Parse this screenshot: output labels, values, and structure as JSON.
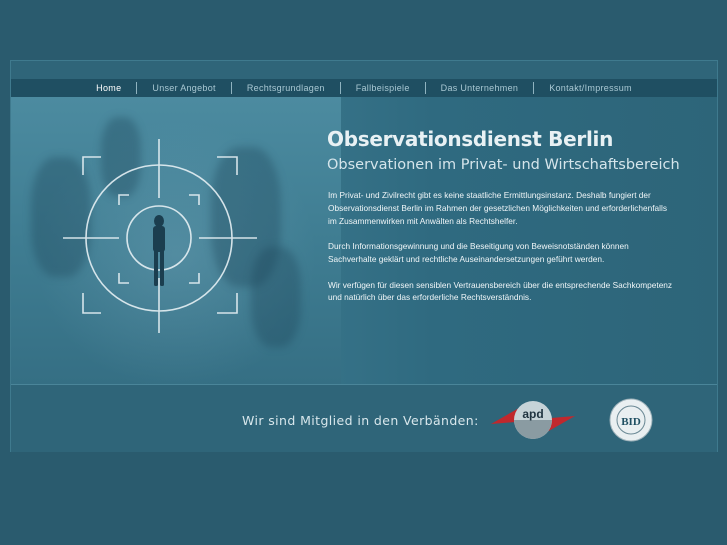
{
  "nav": {
    "items": [
      {
        "label": "Home",
        "active": true
      },
      {
        "label": "Unser Angebot"
      },
      {
        "label": "Rechtsgrundlagen"
      },
      {
        "label": "Fallbeispiele"
      },
      {
        "label": "Das Unternehmen"
      },
      {
        "label": "Kontakt/Impressum"
      }
    ]
  },
  "hero": {
    "title": "Observationsdienst Berlin",
    "subtitle": "Observationen im Privat- und Wirtschaftsbereich",
    "paragraphs": [
      "Im Privat- und Zivilrecht gibt es keine staatliche Ermittlungsinstanz. Deshalb fungiert der Observationsdienst Berlin im Rahmen der gesetzlichen Möglichkeiten und erforderlichenfalls im Zusammenwirken mit Anwälten als Rechtshelfer.",
      "Durch Informationsgewinnung und die Beseitigung von Beweisnotständen können Sachverhalte geklärt und rechtliche Auseinandersetzungen geführt werden.",
      "Wir verfügen für diesen sensiblen Vertrauensbereich über die entsprechende Sachkompetenz und natürlich über das erforderliche Rechtsverständnis."
    ]
  },
  "footer": {
    "member_text": "Wir sind Mitglied in den Verbänden:",
    "logos": [
      {
        "name": "apd-logo",
        "text": "apd"
      },
      {
        "name": "bid-logo",
        "text": "BID"
      }
    ]
  },
  "colors": {
    "background": "#2a5b6e",
    "nav_bg": "#1f4f62",
    "nav_active": "#ffffff",
    "nav_text": "#a9c8d3",
    "apd_red": "#c0282d"
  }
}
